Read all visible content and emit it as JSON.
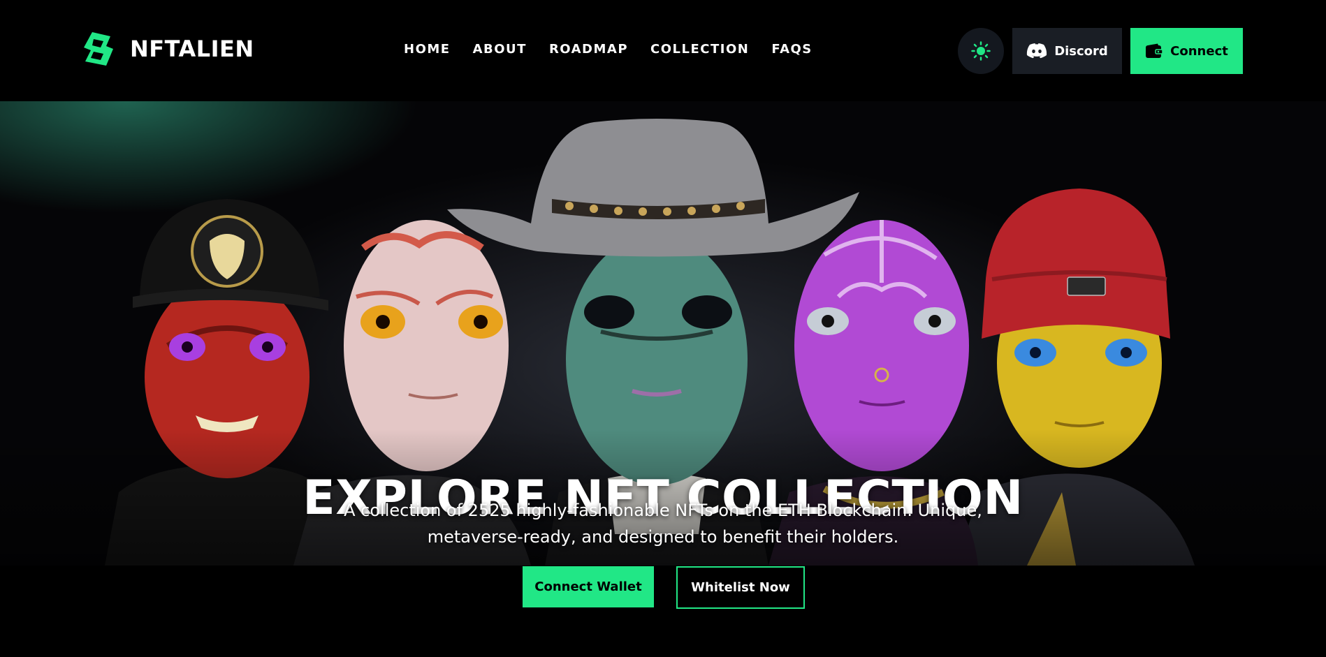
{
  "brand": {
    "name": "NFTALIEN"
  },
  "nav": {
    "items": [
      "HOME",
      "ABOUT",
      "ROADMAP",
      "COLLECTION",
      "FAQS"
    ]
  },
  "header": {
    "theme_toggle_icon": "sun-icon",
    "discord_label": "Discord",
    "connect_label": "Connect"
  },
  "hero": {
    "title": "EXPLORE NFT COLLECTION",
    "subtitle": "A collection of 2525 highly-fashionable NFTs on the ETH Blockchain. Unique, metaverse-ready, and designed to benefit their holders.",
    "primary_cta": "Connect Wallet",
    "secondary_cta": "Whitelist Now"
  },
  "colors": {
    "accent": "#21e786",
    "background": "#000000",
    "button_dark": "#1a1e25"
  }
}
